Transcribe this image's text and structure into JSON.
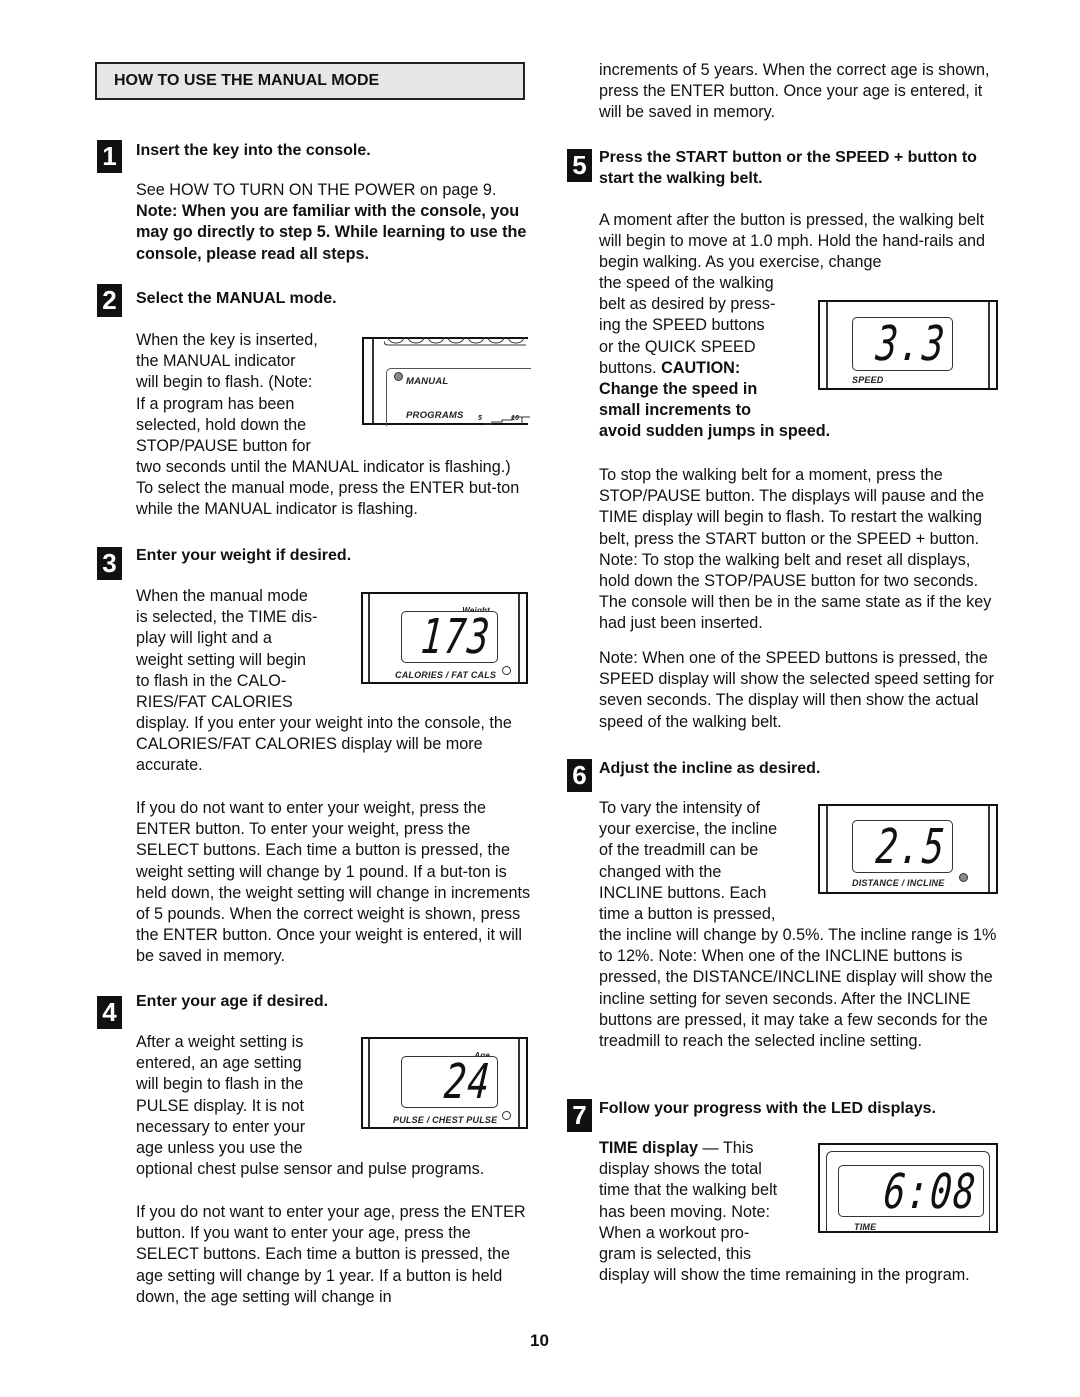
{
  "section_title": "HOW TO USE THE MANUAL MODE",
  "page_number": "10",
  "steps": [
    {
      "number": "1",
      "title": "Insert the key into the console.",
      "body": "See HOW TO TURN ON THE POWER on page 9.",
      "note": "Note: When you are familiar with the console, you may go directly to step 5. While learning to use the console, please read all steps."
    },
    {
      "number": "2",
      "title": "Select the MANUAL mode.",
      "wrap_lines": [
        "When the key is inserted,",
        "the MANUAL indicator",
        "will begin to flash. (Note:",
        "If a program has been",
        "selected, hold down the",
        "STOP/PAUSE button for"
      ],
      "body_after": "two seconds until the MANUAL indicator is flashing.) To select the manual mode, press the ENTER but-ton while the MANUAL indicator is flashing.",
      "illustration": {
        "manual_label": "MANUAL",
        "programs_label": "PROGRAMS",
        "tick_5": "5",
        "tick_10": "10",
        "manual_led_color": "#8a8a8a"
      }
    },
    {
      "number": "3",
      "title": "Enter your weight if desired.",
      "wrap_lines": [
        "When the manual mode",
        "is selected, the TIME dis-",
        "play will light and a",
        "weight setting will begin",
        "to flash in the CALO-",
        "RIES/FAT CALORIES"
      ],
      "body_after": "display. If you enter your weight into the console, the CALORIES/FAT CALORIES display will be more accurate.",
      "body_2": "If you do not want to enter your weight, press the ENTER button. To enter your weight, press the SELECT buttons. Each time a button is pressed, the weight setting will change by 1 pound. If a but-ton is held down, the weight setting will change in increments of 5 pounds. When the correct weight is shown, press the ENTER button. Once your weight is entered, it will be saved in memory.",
      "illustration": {
        "value": "173",
        "top_label": "Weight",
        "bottom_label": "CALORIES / FAT CALS"
      }
    },
    {
      "number": "4",
      "title": "Enter your age if desired.",
      "wrap_lines": [
        "After a weight setting is",
        "entered, an age setting",
        "will begin to flash in the",
        "PULSE display. It is not",
        "necessary to enter your",
        "age unless you use the"
      ],
      "body_after": "optional chest pulse sensor and pulse programs.",
      "body_2": "If you do not want to enter your age, press the ENTER button. If you want to enter your age, press the SELECT buttons. Each time a button is pressed, the age setting will change by 1 year. If a button is held down, the age setting will change in",
      "illustration": {
        "value": "24",
        "top_label": "Age",
        "bottom_label": "PULSE / CHEST PULSE"
      }
    },
    {
      "number": "5",
      "continued_text": "increments of 5 years. When the correct age is shown, press the ENTER button. Once your age is entered, it will be saved in memory.",
      "title": "Press the START button or the SPEED + button to start the walking belt.",
      "body_intro": "A moment after the button is pressed, the walking belt will begin to move at 1.0 mph. Hold the hand-rails and begin walking. As you exercise, change",
      "wrap_lines": [
        "the speed of the walking",
        "belt as desired by press-",
        "ing the SPEED buttons",
        "or the QUICK SPEED"
      ],
      "wrap_last_plain": "buttons. ",
      "caution_label": "CAUTION:",
      "caution_lines": [
        "Change the speed in",
        "small increments to",
        "avoid sudden jumps in speed."
      ],
      "body_2": "To stop the walking belt for a moment, press the STOP/PAUSE button. The displays will pause and the TIME display will begin to flash. To restart the walking belt, press the START button or the SPEED + button. Note: To stop the walking belt and reset all displays, hold down the STOP/PAUSE button for two seconds. The console will then be in the same state as if the key had just been inserted.",
      "body_3": "Note: When one of the SPEED buttons is pressed, the SPEED display will show the selected speed setting for seven seconds. The display will then show the actual speed of the walking belt.",
      "illustration": {
        "value": "3.3",
        "bottom_label": "SPEED"
      }
    },
    {
      "number": "6",
      "title": "Adjust the incline as desired.",
      "wrap_lines": [
        "To vary the intensity of",
        "your exercise, the incline",
        "of the treadmill can be",
        "changed with the",
        "INCLINE buttons. Each",
        "time a button is pressed,"
      ],
      "body_after": "the incline will change by 0.5%. The incline range is 1% to 12%. Note: When one of the INCLINE buttons is pressed, the DISTANCE/INCLINE display will show the incline setting for seven seconds. After the INCLINE buttons are pressed, it may take a few seconds for the treadmill to reach the selected incline setting.",
      "illustration": {
        "value": "2.5",
        "bottom_label": "DISTANCE / INCLINE",
        "led_color": "#8a8a8a"
      }
    },
    {
      "number": "7",
      "title": "Follow your progress with the LED displays.",
      "display_label": "TIME display",
      "wrap_first_rest": " — This",
      "wrap_lines": [
        "display shows the total",
        "time that the walking belt",
        "has been moving. Note:",
        "When a workout pro-",
        "gram is selected, this"
      ],
      "body_after": "display will show the time remaining in the program.",
      "illustration": {
        "value": "6:08",
        "bottom_label": "TIME"
      }
    }
  ]
}
